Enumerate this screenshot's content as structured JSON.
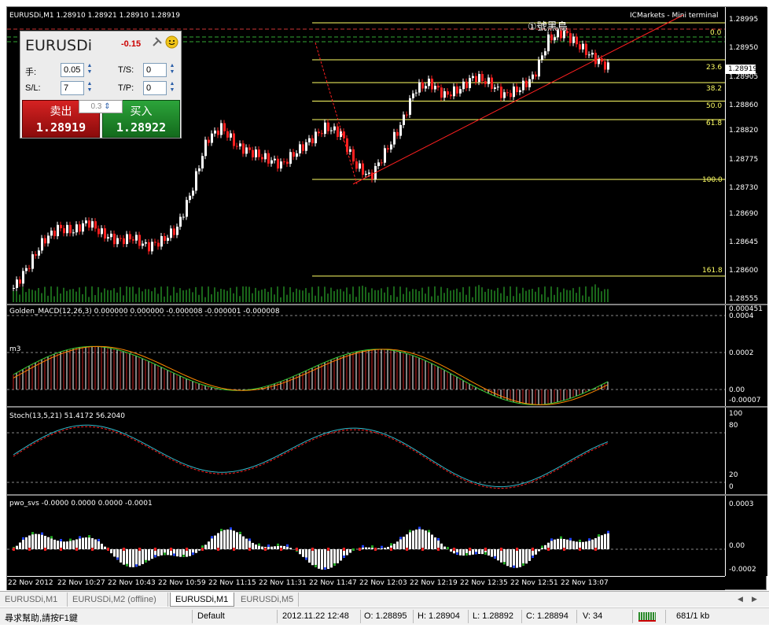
{
  "chart": {
    "header": "EURUSDi,M1  1.28910 1.28921 1.28910 1.28919",
    "broker": "ICMarkets - Mini terminal",
    "annotation": "①號黑鳥",
    "current_price": "1.28919",
    "price_scale": [
      "1.28995",
      "1.28950",
      "1.28905",
      "1.28860",
      "1.28820",
      "1.28775",
      "1.28730",
      "1.28690",
      "1.28645",
      "1.28600",
      "1.28555"
    ],
    "fib_levels": [
      "0.0",
      "23.6",
      "38.2",
      "50.0",
      "61.8",
      "100.0",
      "161.8"
    ],
    "volume_label": "vol"
  },
  "macd": {
    "label": "Golden_MACD(12,26,3) 0.000000 0.000000 -0.000008 -0.000001 -0.000008",
    "marker": "m3",
    "scale": [
      "0.000451",
      "0.0004",
      "0.0002",
      "0.00",
      "-0.00007"
    ]
  },
  "stoch": {
    "label": "Stoch(13,5,21) 51.4172 56.2040",
    "scale": [
      "100",
      "80",
      "20",
      "0"
    ]
  },
  "pwo": {
    "label": "pwo_svs -0.0000 0.0000 0.0000 -0.0001",
    "scale": [
      "0.0003",
      "0.00",
      "-0.0002"
    ]
  },
  "time_axis": [
    "22 Nov 2012",
    "22 Nov 10:27",
    "22 Nov 10:43",
    "22 Nov 10:59",
    "22 Nov 11:15",
    "22 Nov 11:31",
    "22 Nov 11:47",
    "22 Nov 12:03",
    "22 Nov 12:19",
    "22 Nov 12:35",
    "22 Nov 12:51",
    "22 Nov 13:07"
  ],
  "mini_terminal": {
    "symbol": "EURUSDi",
    "spread": "-0.15",
    "lots_label": "手:",
    "lots": "0.05",
    "ts_label": "T/S:",
    "ts": "0",
    "sl_label": "S/L:",
    "sl": "7",
    "tp_label": "T/P:",
    "tp": "0",
    "sell_label": "卖出",
    "sell_price": "1.28919",
    "buy_label": "买入",
    "buy_price": "1.28922",
    "qty": "0.3"
  },
  "tabs": [
    "EURUSDi,M1",
    "EURUSDi,M2 (offline)",
    "EURUSDi,M1",
    "EURUSDi,M5"
  ],
  "status": {
    "help": "尋求幫助,請按F1鍵",
    "profile": "Default",
    "time": "2012.11.22 12:48",
    "open": "O: 1.28895",
    "high": "H: 1.28904",
    "low": "L: 1.28892",
    "close": "C: 1.28894",
    "volume": "V: 34",
    "traffic": "681/1 kb"
  },
  "colors": {
    "bull": "#ffffff",
    "bear": "#ff2020",
    "fib": "#ffff66",
    "volume": "#33cc33",
    "trend": "#ff2020"
  },
  "chart_data": {
    "type": "candlestick",
    "close": [
      1.28565,
      1.286,
      1.2864,
      1.2866,
      1.28655,
      1.2867,
      1.2865,
      1.2864,
      1.28645,
      1.2863,
      1.2864,
      1.2866,
      1.2872,
      1.288,
      1.2882,
      1.2879,
      1.2878,
      1.2877,
      1.2876,
      1.2878,
      1.288,
      1.2882,
      1.2881,
      1.2876,
      1.2874,
      1.2878,
      1.2882,
      1.2888,
      1.2889,
      1.2887,
      1.2888,
      1.289,
      1.2889,
      1.2887,
      1.2888,
      1.289,
      1.2896,
      1.2897,
      1.2895,
      1.2893,
      1.28915
    ],
    "fib_range": [
      1.28737,
      1.28985
    ]
  }
}
